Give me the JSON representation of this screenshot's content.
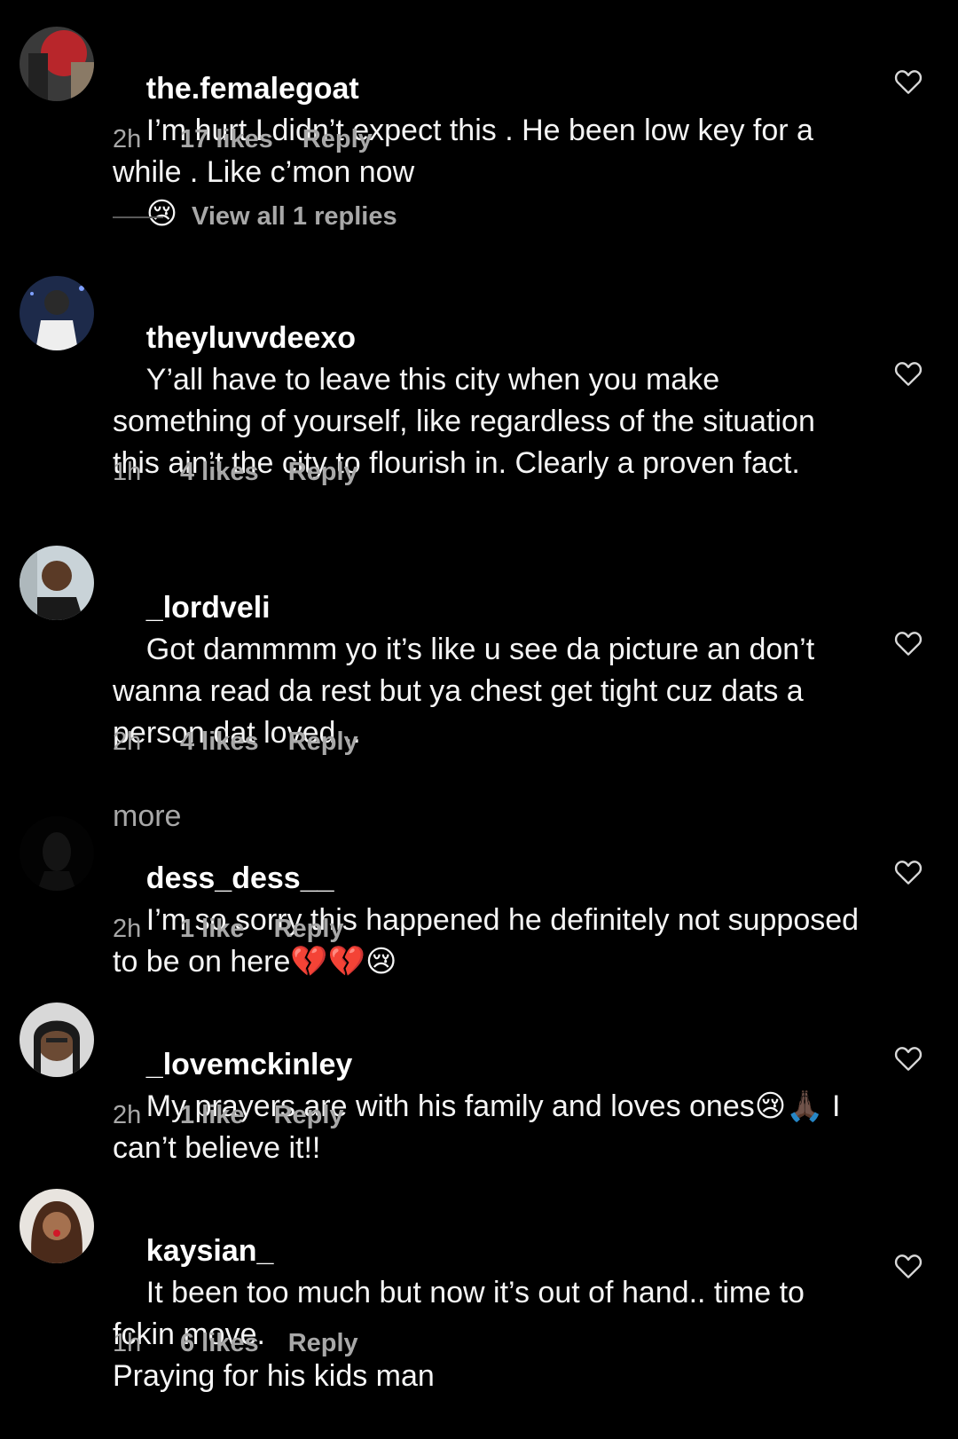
{
  "comments": [
    {
      "username": "the.femalegoat",
      "text": "I’m hurt I didn’t expect this . He been low key for a while . Like c’mon now",
      "emoji_suffix": "😢",
      "time": "2h",
      "likes": "17 likes",
      "reply": "Reply",
      "view_replies": "View all 1 replies"
    },
    {
      "username": "theyluvvdeexo",
      "text": "Y’all have to leave this city when you make something of yourself, like regardless of the situation this ain’t the city to flourish in. Clearly a proven fact.",
      "time": "1h",
      "likes": "4 likes",
      "reply": "Reply"
    },
    {
      "username": "_lordveli",
      "text": "Got dammmm yo it’s like u see da picture an don’t wanna read da rest but ya chest get tight cuz dats a person dat loved...",
      "more": "more",
      "time": "2h",
      "likes": "4 likes",
      "reply": "Reply"
    },
    {
      "username": "dess_dess__",
      "text": "I’m so sorry this happened he definitely not supposed to be on here",
      "emoji_suffix": "💔💔😢",
      "time": "2h",
      "likes": "1 like",
      "reply": "Reply"
    },
    {
      "username": "_lovemckinley",
      "text": "My prayers are with his family and loves ones",
      "emoji_mid": "😢🙏🏿",
      "text_after": " I can’t believe it!!",
      "time": "2h",
      "likes": "1 like",
      "reply": "Reply"
    },
    {
      "username": "kaysian_",
      "text": "It been too much but now it’s out of hand.. time to fckin move.\nPraying for his kids man",
      "time": "1h",
      "likes": "6 likes",
      "reply": "Reply"
    }
  ],
  "colors": {
    "background": "#000000",
    "text": "#f5f5f5",
    "secondary": "#a8a8a8"
  }
}
